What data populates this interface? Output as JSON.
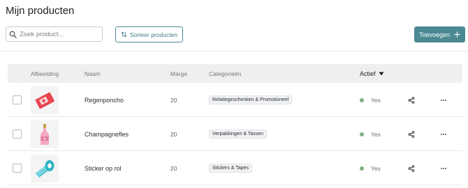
{
  "page": {
    "title": "Mijn producten"
  },
  "toolbar": {
    "search_placeholder": "Zoek product...",
    "sort_label": "Sorteer producten",
    "add_label": "Toevoegen"
  },
  "table": {
    "headers": {
      "image": "Afbeelding",
      "name": "Naam",
      "margin": "Marge",
      "categories": "Categorieën",
      "active": "Actief"
    },
    "rows": [
      {
        "name": "Regenponcho",
        "margin": "20",
        "category": "Relatiegeschenken & Promotioneel",
        "status": "Yes",
        "image_icon": "poncho-package-image"
      },
      {
        "name": "Champagnefles",
        "margin": "20",
        "category": "Verpakkingen & Tassen",
        "status": "Yes",
        "image_icon": "champagne-bottle-image"
      },
      {
        "name": "Sticker op rol",
        "margin": "20",
        "category": "Stickers & Tapes",
        "status": "Yes",
        "image_icon": "sticker-roll-image"
      }
    ]
  },
  "colors": {
    "accent": "#4b8993",
    "status_active": "#7fae7f",
    "header_bg": "#efefef"
  }
}
